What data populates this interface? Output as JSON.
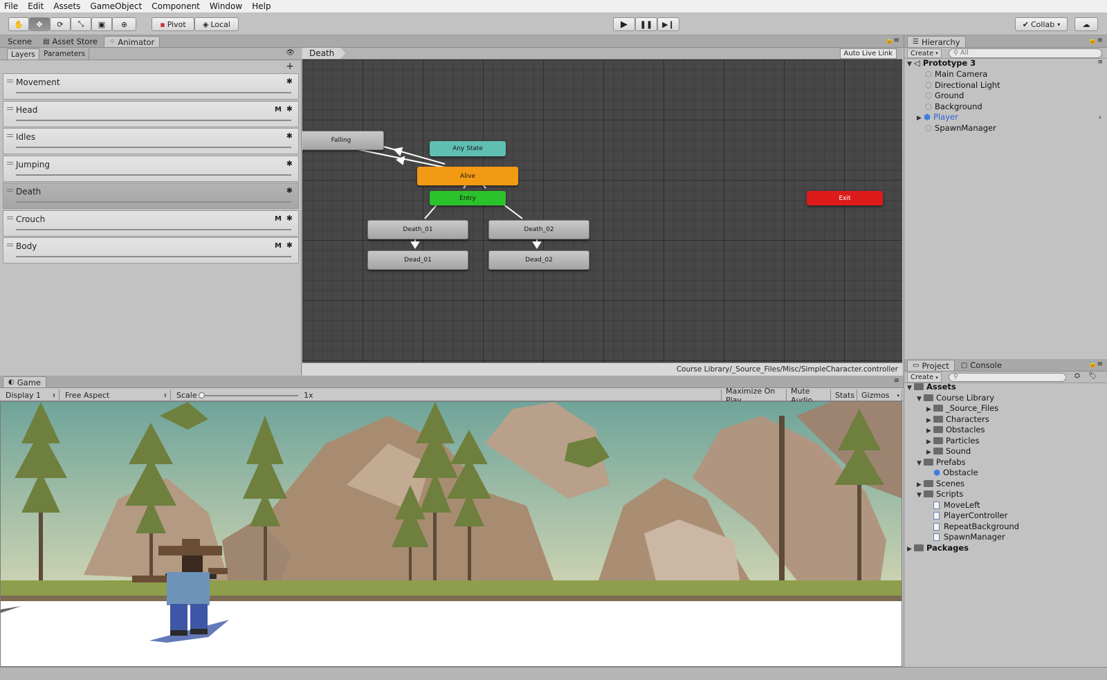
{
  "menu": [
    "File",
    "Edit",
    "Assets",
    "GameObject",
    "Component",
    "Window",
    "Help"
  ],
  "toolbar": {
    "pivot_label": "Pivot",
    "local_label": "Local",
    "collab_label": "Collab"
  },
  "top_tabs": {
    "scene": "Scene",
    "asset_store": "Asset Store",
    "animator": "Animator"
  },
  "animator": {
    "tabs": {
      "layers": "Layers",
      "parameters": "Parameters"
    },
    "breadcrumb": "Death",
    "auto_live_link": "Auto Live Link",
    "path": "Course Library/_Source_Files/Misc/SimpleCharacter.controller",
    "layers": [
      {
        "name": "Movement",
        "m": ""
      },
      {
        "name": "Head",
        "m": "M"
      },
      {
        "name": "Idles",
        "m": ""
      },
      {
        "name": "Jumping",
        "m": ""
      },
      {
        "name": "Death",
        "m": ""
      },
      {
        "name": "Crouch",
        "m": "M"
      },
      {
        "name": "Body",
        "m": "M"
      }
    ],
    "states": {
      "falling": "Falling",
      "any_state": "Any State",
      "alive": "Alive",
      "entry": "Entry",
      "exit": "Exit",
      "death_01": "Death_01",
      "death_02": "Death_02",
      "dead_01": "Dead_01",
      "dead_02": "Dead_02"
    },
    "colors": {
      "any_state": "#5fbfb3",
      "alive": "#f39a14",
      "entry": "#2bc22b",
      "exit": "#dd1b1b"
    }
  },
  "hierarchy": {
    "title": "Hierarchy",
    "create": "Create",
    "search_placeholder": "All",
    "scene": "Prototype 3",
    "items": [
      "Main Camera",
      "Directional Light",
      "Ground",
      "Background",
      "Player",
      "SpawnManager"
    ]
  },
  "project": {
    "tab_project": "Project",
    "tab_console": "Console",
    "create": "Create",
    "assets": "Assets",
    "course_library": "Course Library",
    "course_children": [
      "_Source_Files",
      "Characters",
      "Obstacles",
      "Particles",
      "Sound"
    ],
    "prefabs": "Prefabs",
    "prefab_items": [
      "Obstacle"
    ],
    "scenes": "Scenes",
    "scripts": "Scripts",
    "script_items": [
      "MoveLeft",
      "PlayerController",
      "RepeatBackground",
      "SpawnManager"
    ],
    "packages": "Packages"
  },
  "game": {
    "tab": "Game",
    "display": "Display 1",
    "aspect": "Free Aspect",
    "scale_label": "Scale",
    "scale_value": "1x",
    "scale_level": 0,
    "maximize": "Maximize On Play",
    "mute": "Mute Audio",
    "stats": "Stats",
    "gizmos": "Gizmos"
  }
}
